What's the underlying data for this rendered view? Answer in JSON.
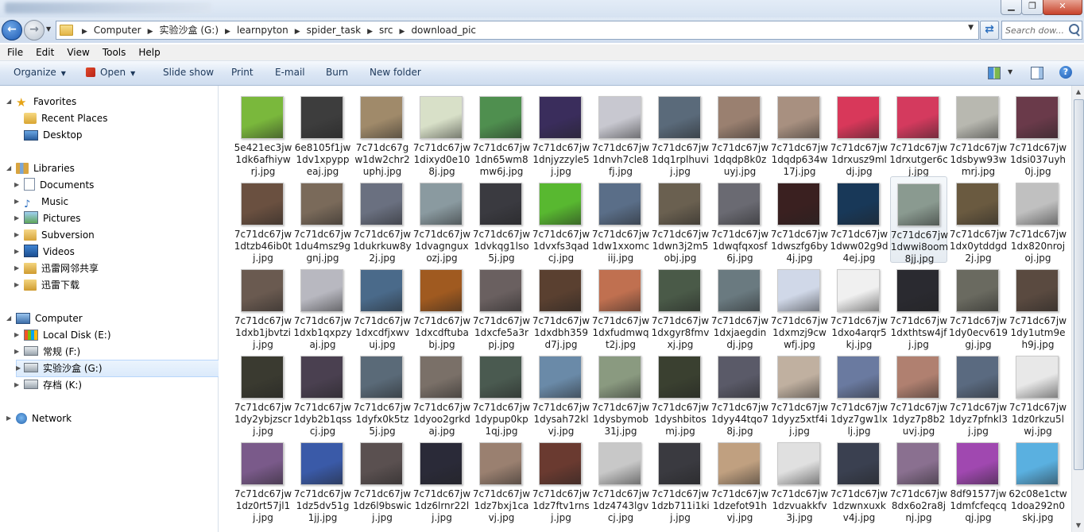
{
  "window": {
    "title": "",
    "min_glyph": "▁",
    "max_glyph": "❐",
    "close_glyph": "✕"
  },
  "nav": {
    "back_glyph": "←",
    "forward_glyph": "→",
    "dropdown_glyph": "▼",
    "breadcrumb": [
      "Computer",
      "实验沙盒 (G:)",
      "learnpyton",
      "spider_task",
      "src",
      "download_pic"
    ],
    "separator": "▶",
    "refresh_glyph": "⇄",
    "search_placeholder": "Search dow..."
  },
  "menu": [
    "File",
    "Edit",
    "View",
    "Tools",
    "Help"
  ],
  "commands": {
    "organize": "Organize",
    "open": "Open",
    "slideshow": "Slide show",
    "print": "Print",
    "email": "E-mail",
    "burn": "Burn",
    "new_folder": "New folder",
    "help_glyph": "?",
    "dropdown_glyph": "▼"
  },
  "sidebar": {
    "favorites": {
      "label": "Favorites",
      "items": [
        "Recent Places",
        "Desktop"
      ]
    },
    "libraries": {
      "label": "Libraries",
      "items": [
        "Documents",
        "Music",
        "Pictures",
        "Subversion",
        "Videos",
        "迅雷网邻共享",
        "迅雷下载"
      ]
    },
    "computer": {
      "label": "Computer",
      "items": [
        "Local Disk (E:)",
        "常规 (F:)",
        "实验沙盒 (G:)",
        "存档 (K:)"
      ]
    },
    "network": {
      "label": "Network"
    },
    "expand_glyph": "▶",
    "collapse_glyph": "◢"
  },
  "files": [
    "5e421ec3jw1dk6afhiywrj.jpg",
    "6e8105f1jw1dv1xpyppeaj.jpg",
    "7c71dc67gw1dw2chr2uphj.jpg",
    "7c71dc67jw1dixyd0e108j.jpg",
    "7c71dc67jw1dn65wm8mw6j.jpg",
    "7c71dc67jw1dnjyzzyle5j.jpg",
    "7c71dc67jw1dnvh7cle8fj.jpg",
    "7c71dc67jw1dq1rplhuvij.jpg",
    "7c71dc67jw1dqdp8k0zuyj.jpg",
    "7c71dc67jw1dqdp634w17j.jpg",
    "7c71dc67jw1drxusz9mldj.jpg",
    "7c71dc67jw1drxutger6cj.jpg",
    "7c71dc67jw1dsbyw93wmrj.jpg",
    "7c71dc67jw1dsi037uyh0j.jpg",
    "7c71dc67jw1dtzb46ib0tj.jpg",
    "7c71dc67jw1du4msz9ggnj.jpg",
    "7c71dc67jw1dukrkuw8y2j.jpg",
    "7c71dc67jw1dvagnguxozj.jpg",
    "7c71dc67jw1dvkqg1lso5j.jpg",
    "7c71dc67jw1dvxfs3qadcj.jpg",
    "7c71dc67jw1dw1xxomciij.jpg",
    "7c71dc67jw1dwn3j2m5obj.jpg",
    "7c71dc67jw1dwqfqxosf6j.jpg",
    "7c71dc67jw1dwszfg6by4j.jpg",
    "7c71dc67jw1dww02g9d4ej.jpg",
    "7c71dc67jw1dwwi8oom8jj.jpg",
    "7c71dc67jw1dx0ytddgd2j.jpg",
    "7c71dc67jw1dx820nrojoj.jpg",
    "7c71dc67jw1dxb1jbvtzij.jpg",
    "7c71dc67jw1dxb1qxpzyaj.jpg",
    "7c71dc67jw1dxcdfjxwvuj.jpg",
    "7c71dc67jw1dxcdftubabj.jpg",
    "7c71dc67jw1dxcfe5a3rpj.jpg",
    "7c71dc67jw1dxdbh359d7j.jpg",
    "7c71dc67jw1dxfudmwqt2j.jpg",
    "7c71dc67jw1dxgyr8fmvxj.jpg",
    "7c71dc67jw1dxjaegdindj.jpg",
    "7c71dc67jw1dxmzj9cwwfj.jpg",
    "7c71dc67jw1dxo4arqr5kj.jpg",
    "7c71dc67jw1dxthtsw4jfj.jpg",
    "7c71dc67jw1dy0ecv619gj.jpg",
    "7c71dc67jw1dy1utm9eh9j.jpg",
    "7c71dc67jw1dy2ybjzscrj.jpg",
    "7c71dc67jw1dyb2b1qsscj.jpg",
    "7c71dc67jw1dyfx0k5tz5j.jpg",
    "7c71dc67jw1dyoo2grkdaj.jpg",
    "7c71dc67jw1dypup0kp1qj.jpg",
    "7c71dc67jw1dysah72klvj.jpg",
    "7c71dc67jw1dysbymob31j.jpg",
    "7c71dc67jw1dyshbitosmj.jpg",
    "7c71dc67jw1dyy44tqo78j.jpg",
    "7c71dc67jw1dyyz5xtf4ij.jpg",
    "7c71dc67jw1dyz7gw1lxlj.jpg",
    "7c71dc67jw1dyz7p8b2uvj.jpg",
    "7c71dc67jw1dyz7pfnkl3j.jpg",
    "7c71dc67jw1dz0rkzu5lwj.jpg",
    "7c71dc67jw1dz0rt57jl1j.jpg",
    "7c71dc67jw1dz5dv51g1jj.jpg",
    "7c71dc67jw1dz6l9bswicj.jpg",
    "7c71dc67jw1dz6lrnr22lj.jpg",
    "7c71dc67jw1dz7bxj1cavj.jpg",
    "7c71dc67jw1dz7ftv1rnsj.jpg",
    "7c71dc67jw1dz4743lgvcj.jpg",
    "7c71dc67jw1dzb711i1kij.jpg",
    "7c71dc67jw1dzefot91hvj.jpg",
    "7c71dc67jw1dzvuakkfv3j.jpg",
    "7c71dc67jw1dzwnxuxkv4j.jpg",
    "7c71dc67jw8dx6o2ra8jnj.jpg",
    "8df91577jw1dmfcfeqcqqj.jpg",
    "62c08e1ctw1doa292n0skj.jpg"
  ],
  "thumbnail_colors": [
    "#7ab83c",
    "#3d3d3d",
    "#a08a6a",
    "#d8e0c8",
    "#4f8f4f",
    "#3a2d5c",
    "#c8c8d0",
    "#5a6a7a",
    "#9a8070",
    "#a89080",
    "#d8385a",
    "#d43a5e",
    "#b8b8b0",
    "#6a3a4a",
    "#6a5040",
    "#7a6a5a",
    "#6a7080",
    "#8a9aa0",
    "#3a3a40",
    "#58b830",
    "#5a6e88",
    "#6a6050",
    "#6a6a72",
    "#3a2020",
    "#183858",
    "#8a9a90",
    "#6a5a40",
    "#c0c0c0",
    "#6a5a50",
    "#b8b8c0",
    "#4a6a8a",
    "#a05a20",
    "#6a6060",
    "#5a4030",
    "#c07050",
    "#4a5a48",
    "#6a7a80",
    "#d0d8e8",
    "#f0f0f0",
    "#2a2a30",
    "#6a6a60",
    "#5a4a40",
    "#3a3a30",
    "#4a4050",
    "#5a6a78",
    "#7a7068",
    "#4a5a50",
    "#6a8aa8",
    "#8a9a80",
    "#3a4030",
    "#5a5a68",
    "#c0b0a0",
    "#6a7aa0",
    "#b08070",
    "#5a6a80",
    "#e8e8e8",
    "#7a5a8a",
    "#3a5aa8",
    "#5a5050",
    "#2a2a38",
    "#9a8070",
    "#6a3a30",
    "#c8c8c8",
    "#3a3a40",
    "#c0a080",
    "#e0e0e0",
    "#3a4050",
    "#8a7090",
    "#a048b0",
    "#5ab0e0"
  ],
  "selected_index": 25
}
